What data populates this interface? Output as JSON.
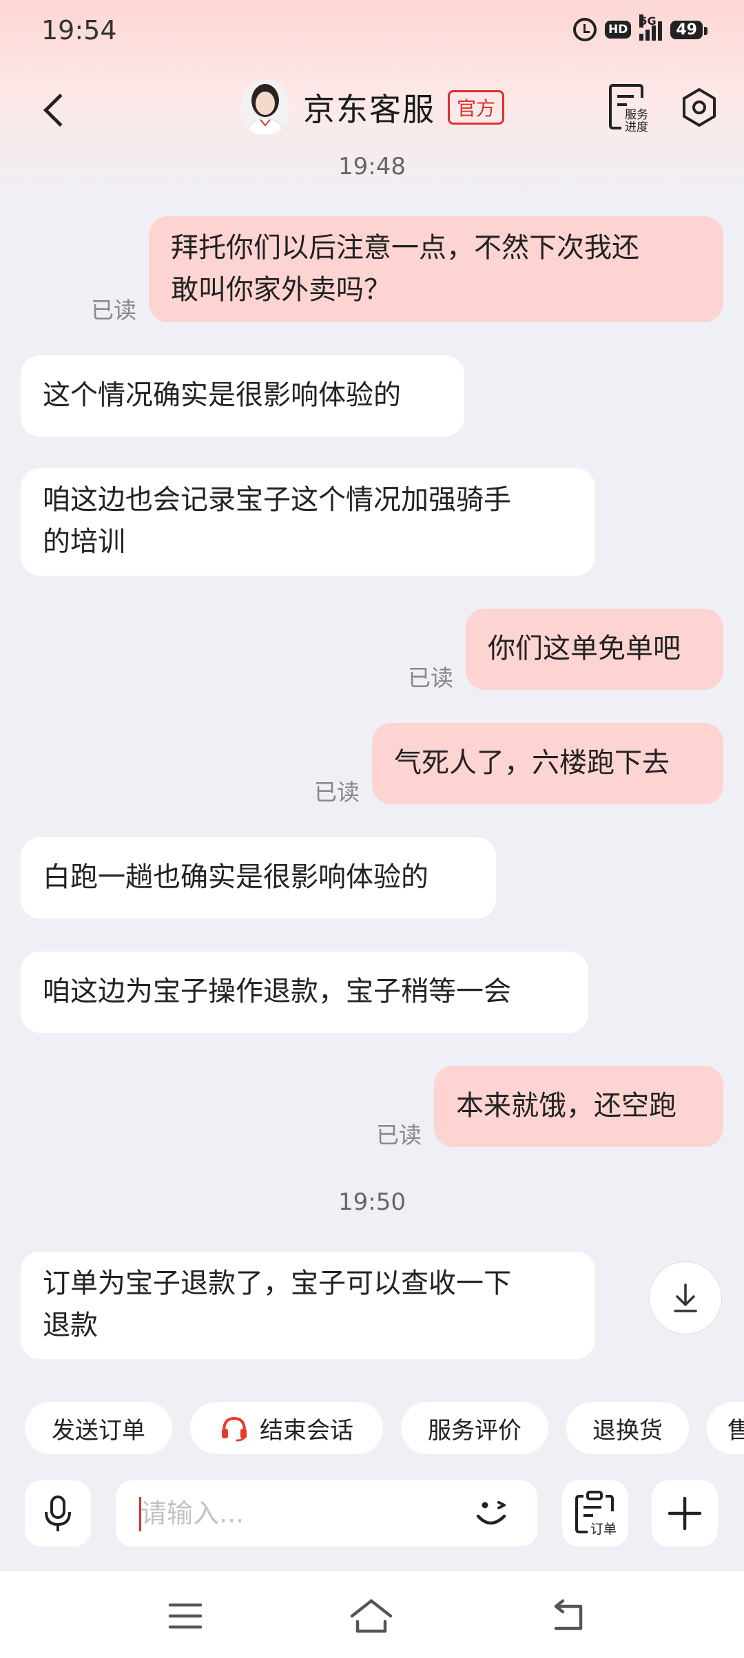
{
  "status_bar": {
    "time": "19:54",
    "hd": "HD",
    "network": "5G",
    "battery": "49"
  },
  "header": {
    "title": "京东客服",
    "badge": "官方",
    "service_progress_label_1": "服务",
    "service_progress_label_2": "进度"
  },
  "timestamps": [
    "19:48",
    "19:50"
  ],
  "messages": [
    {
      "dir": "out",
      "lines": [
        "拜托你们以后注意一点，不然下次我还",
        "敢叫你家外卖吗？"
      ],
      "read": "已读"
    },
    {
      "dir": "in",
      "lines": [
        "这个情况确实是很影响体验的"
      ]
    },
    {
      "dir": "in",
      "lines": [
        "咱这边也会记录宝子这个情况加强骑手",
        "的培训"
      ]
    },
    {
      "dir": "out",
      "lines": [
        "你们这单免单吧"
      ],
      "read": "已读"
    },
    {
      "dir": "out",
      "lines": [
        "气死人了，六楼跑下去"
      ],
      "read": "已读"
    },
    {
      "dir": "in",
      "lines": [
        "白跑一趟也确实是很影响体验的"
      ]
    },
    {
      "dir": "in",
      "lines": [
        "咱这边为宝子操作退款，宝子稍等一会"
      ]
    },
    {
      "dir": "out",
      "lines": [
        "本来就饿，还空跑"
      ],
      "read": "已读"
    },
    {
      "dir": "in",
      "lines": [
        "订单为宝子退款了，宝子可以查收一下",
        "退款"
      ]
    }
  ],
  "quick_actions": [
    "发送订单",
    "结束会话",
    "服务评价",
    "退换货",
    "售"
  ],
  "input": {
    "placeholder": "请输入...",
    "order_label": "订单"
  },
  "colors": {
    "outgoing_bubble": "#fdd4d1",
    "incoming_bubble": "#ffffff",
    "accent": "#e02d2d",
    "background": "#eef0f5"
  }
}
